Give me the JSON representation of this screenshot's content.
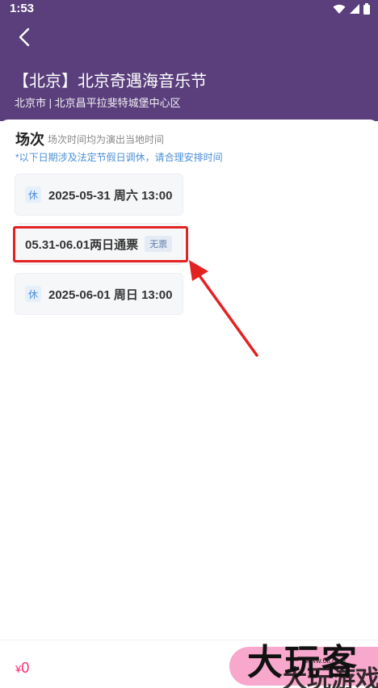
{
  "status_bar": {
    "time": "1:53"
  },
  "header": {
    "title": "【北京】北京奇遇海音乐节",
    "venue": "北京市 | 北京昌平拉斐特城堡中心区"
  },
  "sessions_section": {
    "title": "场次",
    "subtitle": "场次时间均为演出当地时间",
    "holiday_note": "*以下日期涉及法定节假日调休，请合理安排时间",
    "sessions": [
      {
        "rest_tag": "休",
        "label": "2025-05-31 周六 13:00"
      },
      {
        "label": "05.31-06.01两日通票",
        "status": "无票"
      },
      {
        "rest_tag": "休",
        "label": "2025-06-01 周日 13:00"
      }
    ]
  },
  "bottom_bar": {
    "currency": "¥",
    "price": "0"
  },
  "watermark": {
    "text": "大玩客",
    "sub": "大玩游戏",
    "url": "www.6ll.com"
  },
  "colors": {
    "header_bg": "#5a3f7c",
    "accent": "#ff2e6e",
    "annotation": "#e32222"
  }
}
